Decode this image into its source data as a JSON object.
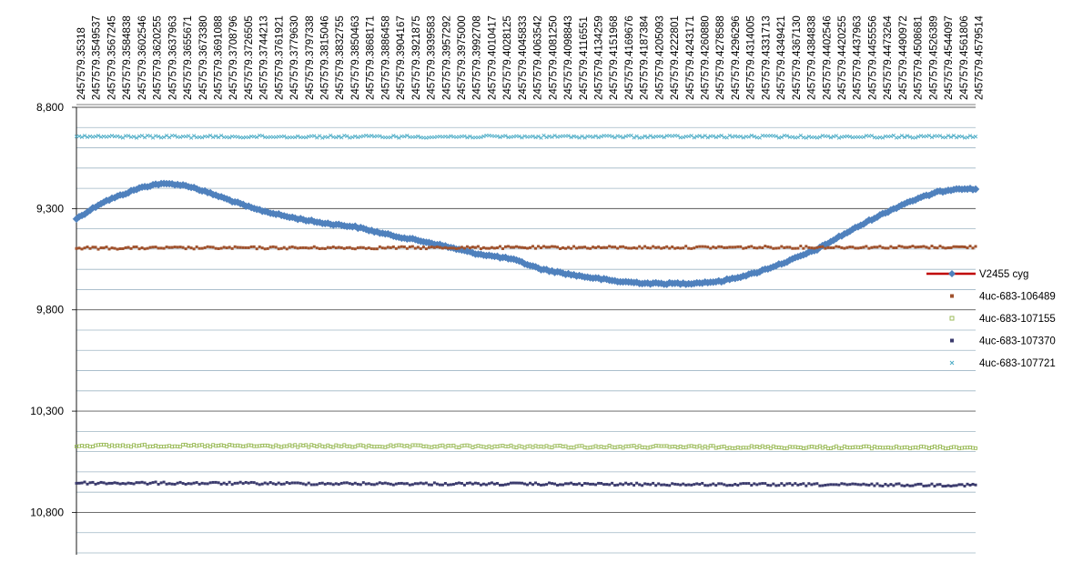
{
  "chart_data": {
    "type": "scatter",
    "title": "",
    "xlabel": "",
    "ylabel": "",
    "y_axis": {
      "inverted": true,
      "ylim": [
        8.8,
        11.0
      ],
      "major_ticks": [
        8.8,
        9.3,
        9.8,
        10.3,
        10.8
      ],
      "major_tick_labels": [
        "8,800",
        "9,300",
        "9,800",
        "10,300",
        "10,800"
      ],
      "minor_gridlines": [
        8.9,
        9.0,
        9.1,
        9.2,
        9.4,
        9.5,
        9.6,
        9.7,
        9.9,
        10.0,
        10.1,
        10.2,
        10.4,
        10.5,
        10.6,
        10.7,
        10.9,
        11.0
      ]
    },
    "grid": true,
    "legend_position": "right",
    "x_axis": {
      "xlim": [
        2457579.35318,
        2457579.4591
      ],
      "tick_labels": [
        "2457579.35318",
        "2457579.3549537",
        "2457579.3567245",
        "2457579.3584838",
        "2457579.3602546",
        "2457579.3620255",
        "2457579.3637963",
        "2457579.3655671",
        "2457579.3673380",
        "2457579.3691088",
        "2457579.3708796",
        "2457579.3726505",
        "2457579.3744213",
        "2457579.3761921",
        "2457579.3779630",
        "2457579.3797338",
        "2457579.3815046",
        "2457579.3832755",
        "2457579.3850463",
        "2457579.3868171",
        "2457579.3886458",
        "2457579.3904167",
        "2457579.3921875",
        "2457579.3939583",
        "2457579.3957292",
        "2457579.3975000",
        "2457579.3992708",
        "2457579.4010417",
        "2457579.4028125",
        "2457579.4045833",
        "2457579.4063542",
        "2457579.4081250",
        "2457579.4098843",
        "2457579.4116551",
        "2457579.4134259",
        "2457579.4151968",
        "2457579.4169676",
        "2457579.4187384",
        "2457579.4205093",
        "2457579.4222801",
        "2457579.4243171",
        "2457579.4260880",
        "2457579.4278588",
        "2457579.4296296",
        "2457579.4314005",
        "2457579.4331713",
        "2457579.4349421",
        "2457579.4367130",
        "2457579.4384838",
        "2457579.4402546",
        "2457579.4420255",
        "2457579.4437963",
        "2457579.4455556",
        "2457579.4473264",
        "2457579.4490972",
        "2457579.4508681",
        "2457579.4526389",
        "2457579.4544097",
        "2457579.4561806",
        "2457579.4579514"
      ]
    },
    "series": [
      {
        "name": "V2455 cyg",
        "color": "#4f81bd",
        "marker": "diamond",
        "legend_color": "#c00000",
        "curve_points": [
          {
            "x": 2457579.35318,
            "y": 9.35
          },
          {
            "x": 2457579.3562,
            "y": 9.27
          },
          {
            "x": 2457579.3605,
            "y": 9.2
          },
          {
            "x": 2457579.3625,
            "y": 9.18
          },
          {
            "x": 2457579.3645,
            "y": 9.178
          },
          {
            "x": 2457579.3665,
            "y": 9.19
          },
          {
            "x": 2457579.37,
            "y": 9.24
          },
          {
            "x": 2457579.374,
            "y": 9.3
          },
          {
            "x": 2457579.378,
            "y": 9.34
          },
          {
            "x": 2457579.382,
            "y": 9.37
          },
          {
            "x": 2457579.386,
            "y": 9.39
          },
          {
            "x": 2457579.39,
            "y": 9.43
          },
          {
            "x": 2457579.395,
            "y": 9.47
          },
          {
            "x": 2457579.4,
            "y": 9.52
          },
          {
            "x": 2457579.4045,
            "y": 9.55
          },
          {
            "x": 2457579.408,
            "y": 9.6
          },
          {
            "x": 2457579.412,
            "y": 9.63
          },
          {
            "x": 2457579.417,
            "y": 9.66
          },
          {
            "x": 2457579.421,
            "y": 9.67
          },
          {
            "x": 2457579.425,
            "y": 9.67
          },
          {
            "x": 2457579.429,
            "y": 9.66
          },
          {
            "x": 2457579.433,
            "y": 9.62
          },
          {
            "x": 2457579.437,
            "y": 9.56
          },
          {
            "x": 2457579.4405,
            "y": 9.5
          },
          {
            "x": 2457579.443,
            "y": 9.44
          },
          {
            "x": 2457579.447,
            "y": 9.35
          },
          {
            "x": 2457579.451,
            "y": 9.27
          },
          {
            "x": 2457579.4545,
            "y": 9.22
          },
          {
            "x": 2457579.457,
            "y": 9.2
          },
          {
            "x": 2457579.4591,
            "y": 9.205
          }
        ]
      },
      {
        "name": "4uc-683-106489",
        "color": "#a0522d",
        "marker": "square",
        "curve_points": [
          {
            "x": 2457579.35318,
            "y": 9.495
          },
          {
            "x": 2457579.4591,
            "y": 9.49
          }
        ]
      },
      {
        "name": "4uc-683-107155",
        "color": "#9bbb59",
        "marker": "hollow-square",
        "curve_points": [
          {
            "x": 2457579.35318,
            "y": 10.47
          },
          {
            "x": 2457579.4591,
            "y": 10.48
          }
        ]
      },
      {
        "name": "4uc-683-107370",
        "color": "#3c3c6e",
        "marker": "square",
        "curve_points": [
          {
            "x": 2457579.35318,
            "y": 10.655
          },
          {
            "x": 2457579.4591,
            "y": 10.665
          }
        ]
      },
      {
        "name": "4uc-683-107721",
        "color": "#4bacc6",
        "marker": "x",
        "curve_points": [
          {
            "x": 2457579.35318,
            "y": 8.945
          },
          {
            "x": 2457579.4591,
            "y": 8.945
          }
        ]
      }
    ]
  }
}
